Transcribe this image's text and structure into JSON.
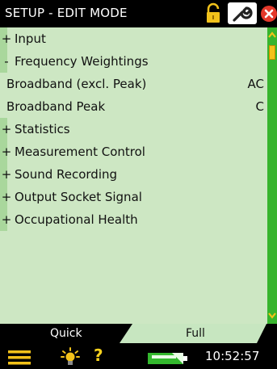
{
  "titlebar": {
    "title": "SETUP - EDIT MODE",
    "icons": [
      "lock-icon",
      "wrench-icon",
      "close-icon"
    ]
  },
  "colors": {
    "list_background": "#cde7c3",
    "gutter": "#a9d79c",
    "scrollbar": "#37b42d",
    "scroll_thumb": "#f3c21a",
    "close_red": "#e4382a"
  },
  "rows": [
    {
      "sign": "+",
      "label": "Input",
      "value": ""
    },
    {
      "sign": "-",
      "label": "Frequency Weightings",
      "value": ""
    },
    {
      "sign": "",
      "label": "Broadband (excl. Peak)",
      "value": "AC"
    },
    {
      "sign": "",
      "label": "Broadband Peak",
      "value": "C"
    },
    {
      "sign": "+",
      "label": "Statistics",
      "value": ""
    },
    {
      "sign": "+",
      "label": "Measurement Control",
      "value": ""
    },
    {
      "sign": "+",
      "label": "Sound Recording",
      "value": ""
    },
    {
      "sign": "+",
      "label": "Output Socket Signal",
      "value": ""
    },
    {
      "sign": "+",
      "label": "Occupational Health",
      "value": ""
    }
  ],
  "tabs": {
    "quick_label": "Quick",
    "full_label": "Full",
    "selected": "Full"
  },
  "statusbar": {
    "icons": [
      "menu-icon",
      "backlight-icon",
      "help-icon",
      "battery-icon"
    ],
    "help_label": "?",
    "time": "10:52:57"
  }
}
